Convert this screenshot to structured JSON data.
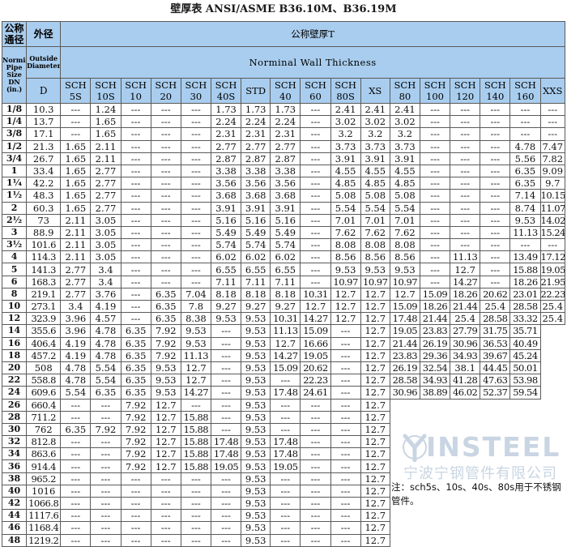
{
  "title": "壁厚表 ANSI/ASME B36.10M、B36.19M",
  "header": {
    "nominal_size_cn": "公称通径",
    "outside_diameter_cn": "外径",
    "wall_thickness_cn": "公称壁厚T",
    "nominal_size_en": "Norminal Pipe Size DN (in.)",
    "outside_diameter_en": "Outside Diameter",
    "wall_thickness_en": "Norminal Wall Thickness",
    "d_label": "D",
    "schedules": [
      {
        "top": "SCH",
        "bottom": "5S"
      },
      {
        "top": "SCH",
        "bottom": "10S"
      },
      {
        "top": "SCH",
        "bottom": "10"
      },
      {
        "top": "SCH",
        "bottom": "20"
      },
      {
        "top": "SCH",
        "bottom": "30"
      },
      {
        "top": "SCH",
        "bottom": "40S"
      },
      {
        "top": "",
        "bottom": "STD"
      },
      {
        "top": "SCH",
        "bottom": "40"
      },
      {
        "top": "SCH",
        "bottom": "60"
      },
      {
        "top": "SCH",
        "bottom": "80S"
      },
      {
        "top": "",
        "bottom": "XS"
      },
      {
        "top": "SCH",
        "bottom": "80"
      },
      {
        "top": "SCH",
        "bottom": "100"
      },
      {
        "top": "SCH",
        "bottom": "120"
      },
      {
        "top": "SCH",
        "bottom": "140"
      },
      {
        "top": "SCH",
        "bottom": "160"
      },
      {
        "top": "",
        "bottom": "XXS"
      }
    ]
  },
  "rows": [
    [
      "1/8",
      "10.3",
      "---",
      "1.24",
      "---",
      "---",
      "---",
      "1.73",
      "1.73",
      "1.73",
      "---",
      "2.41",
      "2.41",
      "2.41",
      "---",
      "---",
      "---",
      "---",
      "---"
    ],
    [
      "1/4",
      "13.7",
      "---",
      "1.65",
      "---",
      "---",
      "---",
      "2.24",
      "2.24",
      "2.24",
      "---",
      "3.02",
      "3.02",
      "3.02",
      "---",
      "---",
      "---",
      "---",
      "---"
    ],
    [
      "3/8",
      "17.1",
      "---",
      "1.65",
      "---",
      "---",
      "---",
      "2.31",
      "2.31",
      "2.31",
      "---",
      "3.2",
      "3.2",
      "3.2",
      "---",
      "---",
      "---",
      "---",
      "---"
    ],
    [
      "1/2",
      "21.3",
      "1.65",
      "2.11",
      "---",
      "---",
      "---",
      "2.77",
      "2.77",
      "2.77",
      "---",
      "3.73",
      "3.73",
      "3.73",
      "---",
      "---",
      "---",
      "4.78",
      "7.47"
    ],
    [
      "3/4",
      "26.7",
      "1.65",
      "2.11",
      "---",
      "---",
      "---",
      "2.87",
      "2.87",
      "2.87",
      "---",
      "3.91",
      "3.91",
      "3.91",
      "---",
      "---",
      "---",
      "5.56",
      "7.82"
    ],
    [
      "1",
      "33.4",
      "1.65",
      "2.77",
      "---",
      "---",
      "---",
      "3.38",
      "3.38",
      "3.38",
      "---",
      "4.55",
      "4.55",
      "4.55",
      "---",
      "---",
      "---",
      "6.35",
      "9.09"
    ],
    [
      "1¼",
      "42.2",
      "1.65",
      "2.77",
      "---",
      "---",
      "---",
      "3.56",
      "3.56",
      "3.56",
      "---",
      "4.85",
      "4.85",
      "4.85",
      "---",
      "---",
      "---",
      "6.35",
      "9.7"
    ],
    [
      "1½",
      "48.3",
      "1.65",
      "2.77",
      "---",
      "---",
      "---",
      "3.68",
      "3.68",
      "3.68",
      "---",
      "5.08",
      "5.08",
      "5.08",
      "---",
      "---",
      "---",
      "7.14",
      "10.15"
    ],
    [
      "2",
      "60.3",
      "1.65",
      "2.77",
      "---",
      "---",
      "---",
      "3.91",
      "3.91",
      "3.91",
      "---",
      "5.54",
      "5.54",
      "5.54",
      "---",
      "---",
      "---",
      "8.74",
      "11.07"
    ],
    [
      "2½",
      "73",
      "2.11",
      "3.05",
      "---",
      "---",
      "---",
      "5.16",
      "5.16",
      "5.16",
      "---",
      "7.01",
      "7.01",
      "7.01",
      "---",
      "---",
      "---",
      "9.53",
      "14.02"
    ],
    [
      "3",
      "88.9",
      "2.11",
      "3.05",
      "---",
      "---",
      "---",
      "5.49",
      "5.49",
      "5.49",
      "---",
      "7.62",
      "7.62",
      "7.62",
      "---",
      "---",
      "---",
      "11.13",
      "15.24"
    ],
    [
      "3½",
      "101.6",
      "2.11",
      "3.05",
      "---",
      "---",
      "---",
      "5.74",
      "5.74",
      "5.74",
      "---",
      "8.08",
      "8.08",
      "8.08",
      "---",
      "---",
      "---",
      "---",
      "---"
    ],
    [
      "4",
      "114.3",
      "2.11",
      "3.05",
      "---",
      "---",
      "---",
      "6.02",
      "6.02",
      "6.02",
      "---",
      "8.56",
      "8.56",
      "8.56",
      "---",
      "11.13",
      "---",
      "13.49",
      "17.12"
    ],
    [
      "5",
      "141.3",
      "2.77",
      "3.4",
      "---",
      "---",
      "---",
      "6.55",
      "6.55",
      "6.55",
      "---",
      "9.53",
      "9.53",
      "9.53",
      "---",
      "12.7",
      "---",
      "15.88",
      "19.05"
    ],
    [
      "6",
      "168.3",
      "2.77",
      "3.4",
      "---",
      "---",
      "---",
      "7.11",
      "7.11",
      "7.11",
      "---",
      "10.97",
      "10.97",
      "10.97",
      "---",
      "14.27",
      "---",
      "18.26",
      "21.95"
    ],
    [
      "8",
      "219.1",
      "2.77",
      "3.76",
      "---",
      "6.35",
      "7.04",
      "8.18",
      "8.18",
      "8.18",
      "10.31",
      "12.7",
      "12.7",
      "12.7",
      "15.09",
      "18.26",
      "20.62",
      "23.01",
      "22.23"
    ],
    [
      "10",
      "273.1",
      "3.4",
      "4.19",
      "---",
      "6.35",
      "7.8",
      "9.27",
      "9.27",
      "9.27",
      "12.7",
      "12.7",
      "12.7",
      "15.09",
      "18.26",
      "21.44",
      "25.4",
      "28.58",
      "25.4"
    ],
    [
      "12",
      "323.9",
      "3.96",
      "4.57",
      "---",
      "6.35",
      "8.38",
      "9.53",
      "9.53",
      "10.31",
      "14.27",
      "12.7",
      "12.7",
      "17.48",
      "21.44",
      "25.4",
      "28.58",
      "33.32",
      "25.4"
    ],
    [
      "14",
      "355.6",
      "3.96",
      "4.78",
      "6.35",
      "7.92",
      "9.53",
      "---",
      "9.53",
      "11.13",
      "15.09",
      "---",
      "12.7",
      "19.05",
      "23.83",
      "27.79",
      "31.75",
      "35.71",
      ""
    ],
    [
      "16",
      "406.4",
      "4.19",
      "4.78",
      "6.35",
      "7.92",
      "9.53",
      "---",
      "9.53",
      "12.7",
      "16.66",
      "---",
      "12.7",
      "21.44",
      "26.19",
      "30.96",
      "36.53",
      "40.49",
      ""
    ],
    [
      "18",
      "457.2",
      "4.19",
      "4.78",
      "6.35",
      "7.92",
      "11.13",
      "---",
      "9.53",
      "14.27",
      "19.05",
      "---",
      "12.7",
      "23.83",
      "29.36",
      "34.93",
      "39.67",
      "45.24",
      ""
    ],
    [
      "20",
      "508",
      "4.78",
      "5.54",
      "6.35",
      "9.53",
      "12.7",
      "---",
      "9.53",
      "15.09",
      "20.62",
      "---",
      "12.7",
      "26.19",
      "32.54",
      "38.1",
      "44.45",
      "50.01",
      ""
    ],
    [
      "22",
      "558.8",
      "4.78",
      "5.54",
      "6.35",
      "9.53",
      "12.7",
      "---",
      "9.53",
      "---",
      "22.23",
      "---",
      "12.7",
      "28.58",
      "34.93",
      "41.28",
      "47.63",
      "53.98",
      ""
    ],
    [
      "24",
      "609.6",
      "5.54",
      "6.35",
      "6.35",
      "9.53",
      "14.27",
      "---",
      "9.53",
      "17.48",
      "24.61",
      "---",
      "12.7",
      "30.96",
      "38.89",
      "46.02",
      "52.37",
      "59.54",
      ""
    ],
    [
      "26",
      "660.4",
      "---",
      "---",
      "7.92",
      "12.7",
      "---",
      "---",
      "9.53",
      "---",
      "---",
      "---",
      "12.7",
      "",
      "",
      "",
      "",
      "",
      ""
    ],
    [
      "28",
      "711.2",
      "---",
      "---",
      "7.92",
      "12.7",
      "15.88",
      "---",
      "9.53",
      "---",
      "---",
      "---",
      "12.7",
      "",
      "",
      "",
      "",
      "",
      ""
    ],
    [
      "30",
      "762",
      "6.35",
      "7.92",
      "7.92",
      "12.7",
      "15.88",
      "---",
      "9.53",
      "---",
      "---",
      "---",
      "12.7",
      "",
      "",
      "",
      "",
      "",
      ""
    ],
    [
      "32",
      "812.8",
      "---",
      "---",
      "7.92",
      "12.7",
      "15.88",
      "17.48",
      "9.53",
      "17.48",
      "---",
      "---",
      "12.7",
      "",
      "",
      "",
      "",
      "",
      ""
    ],
    [
      "34",
      "863.6",
      "---",
      "---",
      "7.92",
      "12.7",
      "15.88",
      "17.48",
      "9.53",
      "17.48",
      "---",
      "---",
      "12.7",
      "",
      "",
      "",
      "",
      "",
      ""
    ],
    [
      "36",
      "914.4",
      "---",
      "---",
      "7.92",
      "12.7",
      "15.88",
      "19.05",
      "9.53",
      "19.05",
      "---",
      "---",
      "12.7",
      "",
      "",
      "",
      "",
      "",
      ""
    ],
    [
      "38",
      "965.2",
      "---",
      "---",
      "---",
      "---",
      "---",
      "---",
      "9.53",
      "---",
      "---",
      "---",
      "12.7",
      "",
      "",
      "",
      "",
      "",
      ""
    ],
    [
      "40",
      "1016",
      "---",
      "---",
      "---",
      "---",
      "---",
      "---",
      "9.53",
      "---",
      "---",
      "---",
      "12.7",
      "",
      "",
      "",
      "",
      "",
      ""
    ],
    [
      "42",
      "1066.8",
      "---",
      "---",
      "---",
      "---",
      "---",
      "---",
      "9.53",
      "---",
      "---",
      "---",
      "12.7",
      "",
      "",
      "",
      "",
      "",
      ""
    ],
    [
      "44",
      "1117.6",
      "---",
      "---",
      "---",
      "---",
      "---",
      "---",
      "9.53",
      "---",
      "---",
      "---",
      "12.7",
      "",
      "",
      "",
      "",
      "",
      ""
    ],
    [
      "46",
      "1168.4",
      "---",
      "---",
      "---",
      "---",
      "---",
      "---",
      "9.53",
      "---",
      "---",
      "---",
      "12.7",
      "",
      "",
      "",
      "",
      "",
      ""
    ],
    [
      "48",
      "1219.2",
      "---",
      "---",
      "---",
      "---",
      "---",
      "---",
      "9.53",
      "---",
      "---",
      "---",
      "12.7",
      "",
      "",
      "",
      "",
      "",
      ""
    ]
  ],
  "watermark": {
    "word": "INSTEEL",
    "company": "宁波宁钢管件有限公司",
    "color": "#c9d5e2"
  },
  "note": "注：sch5s、10s、40s、80s用于不锈钢管件。",
  "colors": {
    "header_bg": "#a9cdee",
    "border": "#5a5a5a"
  }
}
